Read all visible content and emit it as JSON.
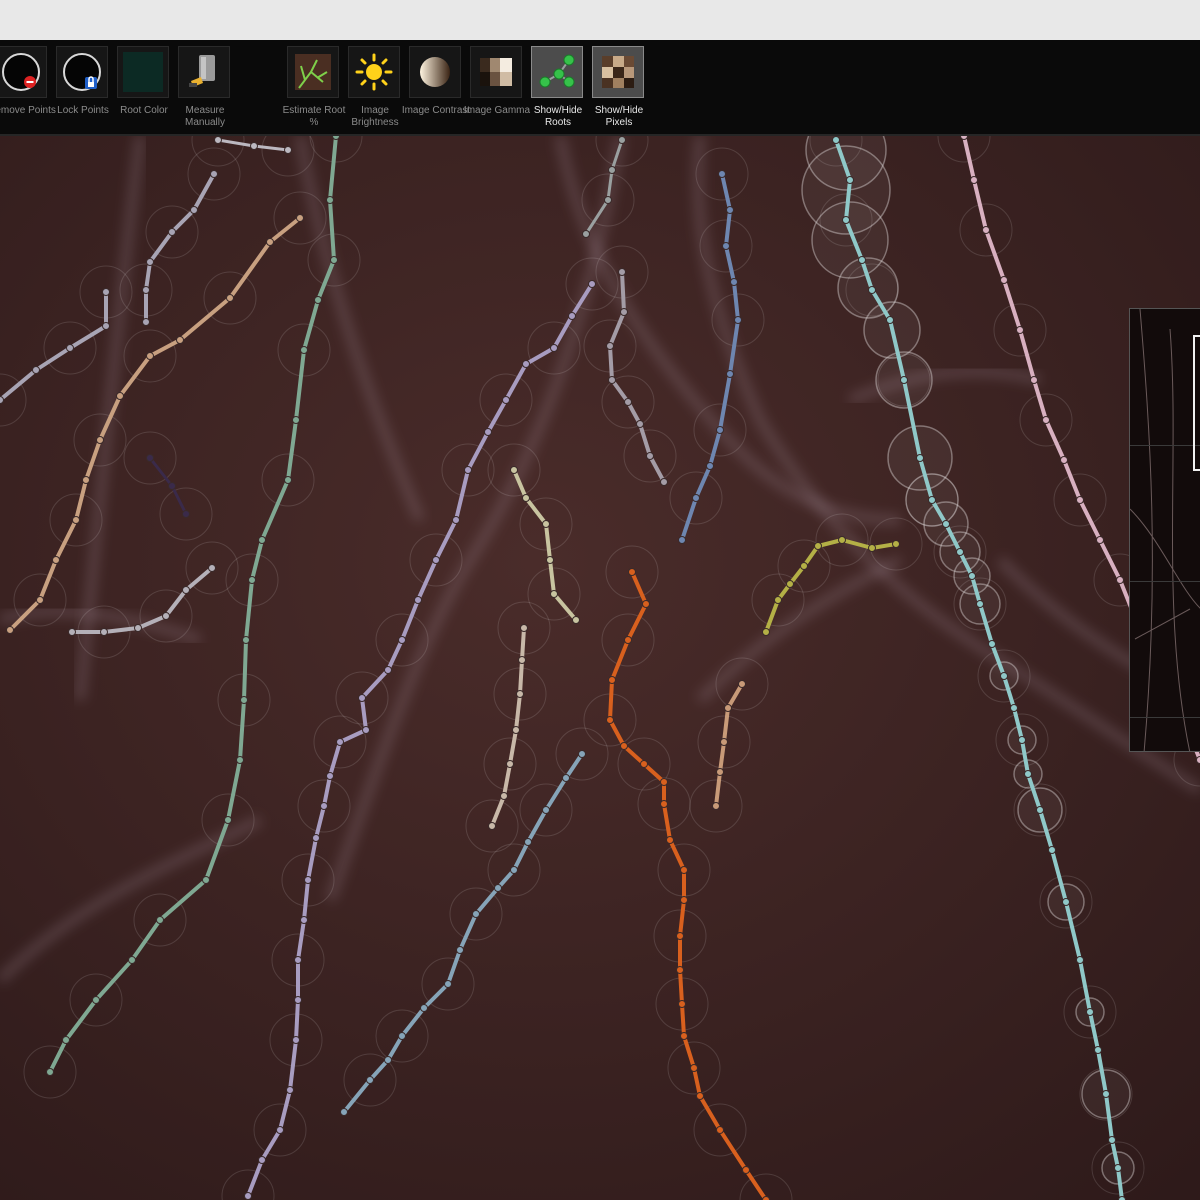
{
  "toolbar": {
    "tools": [
      {
        "id": "remove-points",
        "label": "Remove Points",
        "icon": "remove-points-icon"
      },
      {
        "id": "lock-points",
        "label": "Lock Points",
        "icon": "lock-points-icon"
      },
      {
        "id": "root-color",
        "label": "Root Color",
        "icon": "root-color-swatch",
        "color": "#0c2a24"
      },
      {
        "id": "measure-manually",
        "label": "Measure Manually",
        "icon": "measure-manually-icon"
      },
      {
        "id": "estimate-root",
        "label": "Estimate Root %",
        "icon": "estimate-root-icon"
      },
      {
        "id": "image-brightness",
        "label": "Image Brightness",
        "icon": "sun-icon"
      },
      {
        "id": "image-contrast",
        "label": "Image Contrast",
        "icon": "contrast-icon"
      },
      {
        "id": "image-gamma",
        "label": "Image Gamma",
        "icon": "gamma-icon"
      },
      {
        "id": "show-hide-roots",
        "label": "Show/Hide Roots",
        "icon": "roots-toggle-icon",
        "active": true
      },
      {
        "id": "show-hide-pixels",
        "label": "Show/Hide Pixels",
        "icon": "pixels-toggle-icon",
        "active": true
      }
    ]
  },
  "colors": {
    "toolbar_bg": "#0a0a0a",
    "canvas_bg": "#3a2323",
    "root_teal": "#7fa892",
    "root_cyan": "#8fc8c8",
    "root_orange": "#d8601e",
    "root_lavender": "#a89cc0",
    "root_blue": "#6e86b0",
    "root_steel": "#86a4b8",
    "root_tan": "#c8a080",
    "root_gray": "#a8a4b4",
    "root_olive": "#b4b046",
    "root_cream": "#c8c4a0",
    "root_pink": "#d8b0c0"
  }
}
